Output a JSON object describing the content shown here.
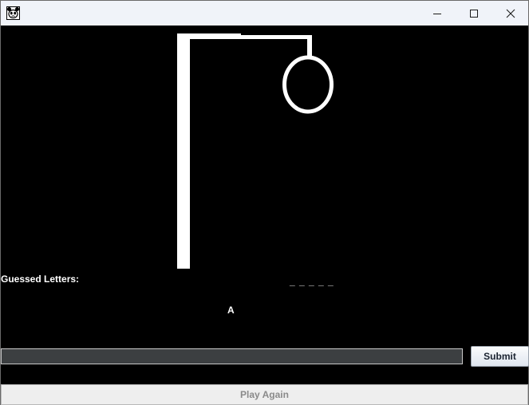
{
  "window": {
    "app_icon": "panda-face-icon",
    "controls": [
      "minimize-icon",
      "maximize-icon",
      "close-icon"
    ]
  },
  "game": {
    "guessed_label": "Guessed Letters:",
    "word_mask": "_ _ _ _ _",
    "guessed_letters": "A",
    "input_value": "",
    "submit_label": "Submit",
    "play_again_label": "Play Again"
  },
  "colors": {
    "background": "#000000",
    "drawing": "#ffffff",
    "input_bg": "#3c3f41",
    "titlebar": "#f0f3f9"
  }
}
